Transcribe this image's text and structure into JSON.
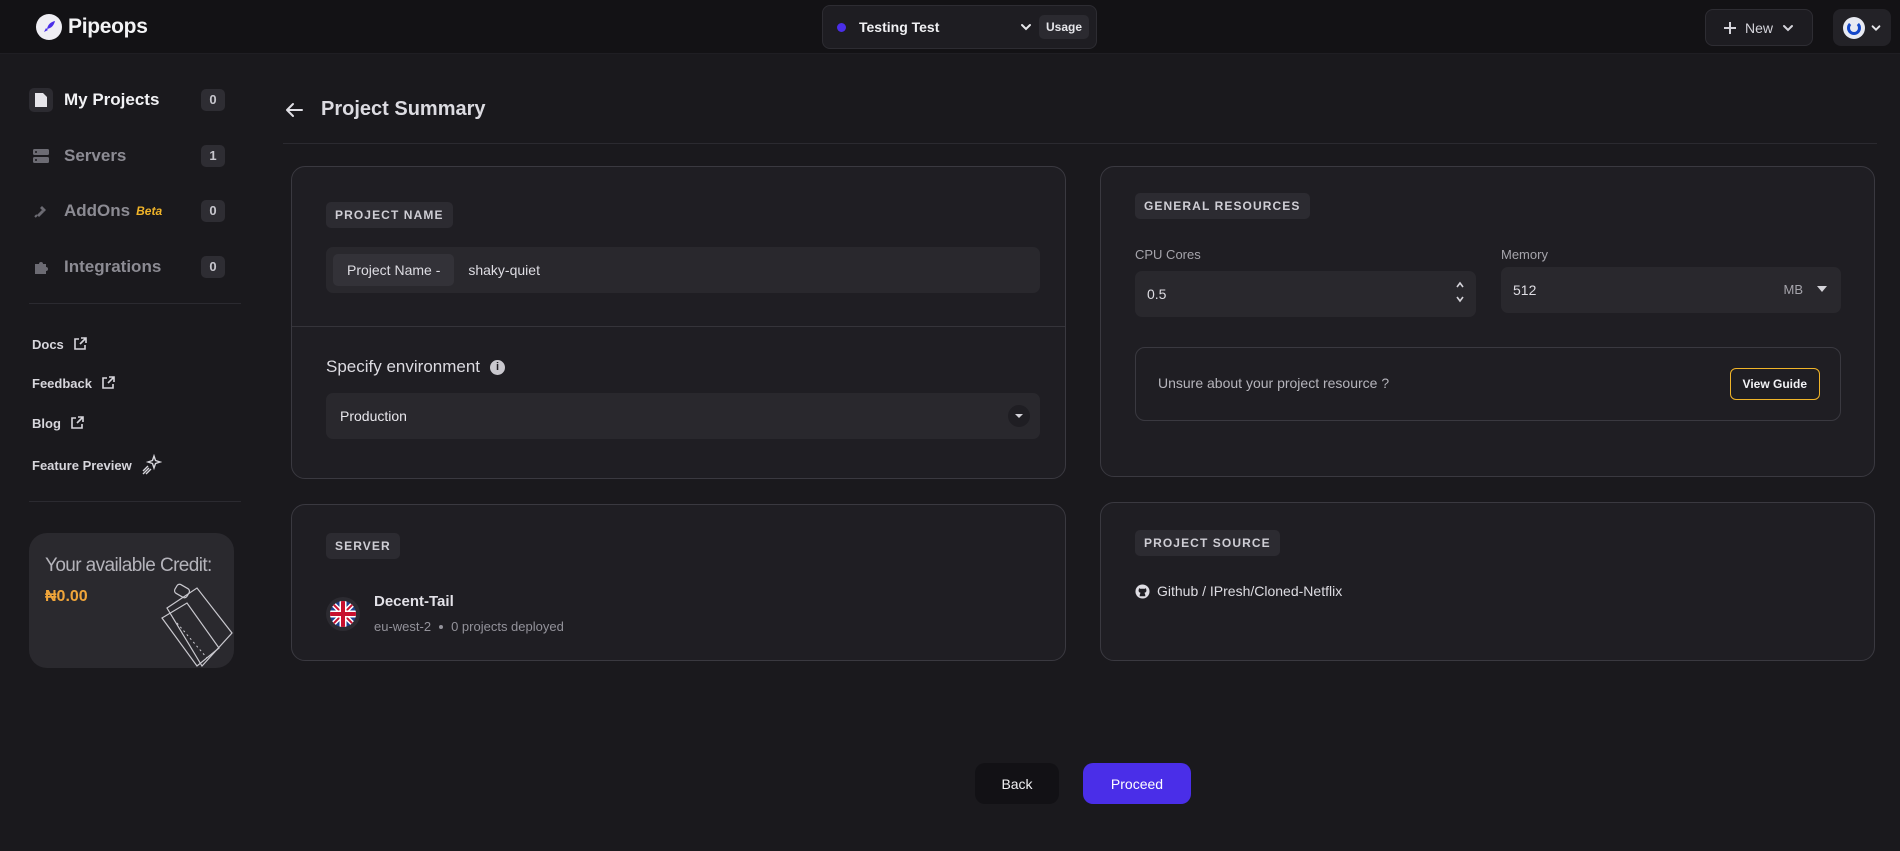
{
  "header": {
    "app_name": "Pipeops",
    "project_switcher": {
      "name": "Testing Test",
      "usage_label": "Usage"
    },
    "new_label": "New"
  },
  "sidebar": {
    "items": [
      {
        "label": "My Projects",
        "count": "0",
        "icon": "file-icon"
      },
      {
        "label": "Servers",
        "count": "1",
        "icon": "server-icon"
      },
      {
        "label": "AddOns",
        "beta": "Beta",
        "count": "0",
        "icon": "plug-icon"
      },
      {
        "label": "Integrations",
        "count": "0",
        "icon": "puzzle-icon"
      }
    ],
    "links": [
      {
        "label": "Docs",
        "icon": "external-link-icon"
      },
      {
        "label": "Feedback",
        "icon": "external-link-icon"
      },
      {
        "label": "Blog",
        "icon": "external-link-icon"
      },
      {
        "label": "Feature Preview",
        "icon": "sparkle-icon"
      }
    ],
    "credit": {
      "title": "Your available Credit:",
      "amount": "₦0.00"
    }
  },
  "main": {
    "title": "Project Summary",
    "project_name": {
      "tag": "PROJECT NAME",
      "prefix": "Project Name -",
      "value": "shaky-quiet"
    },
    "environment": {
      "label": "Specify environment",
      "value": "Production"
    },
    "resources": {
      "tag": "GENERAL RESOURCES",
      "cpu_label": "CPU Cores",
      "cpu_value": "0.5",
      "memory_label": "Memory",
      "memory_value": "512",
      "memory_unit": "MB",
      "guide_text": "Unsure about your project resource ?",
      "guide_button": "View Guide"
    },
    "server": {
      "tag": "SERVER",
      "name": "Decent-Tail",
      "region": "eu-west-2",
      "deployments": "0 projects deployed"
    },
    "source": {
      "tag": "PROJECT SOURCE",
      "value": "Github / IPresh/Cloned-Netflix"
    },
    "actions": {
      "back": "Back",
      "proceed": "Proceed"
    }
  },
  "colors": {
    "accent": "#4a2ee8",
    "warning": "#f0b429",
    "background": "#1a191d"
  }
}
